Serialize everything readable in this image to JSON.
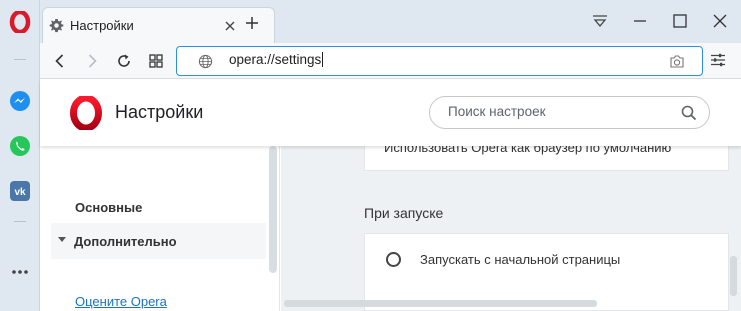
{
  "tab": {
    "title": "Настройки"
  },
  "addressbar": {
    "url": "opera://settings"
  },
  "header": {
    "title": "Настройки",
    "search_placeholder": "Поиск настроек"
  },
  "nav": {
    "basic": "Основные",
    "advanced": "Дополнительно",
    "rate": "Оцените Opera"
  },
  "content": {
    "default_browser": "Использовать Opera как браузер по умолчанию",
    "startup_heading": "При запуске",
    "startup_option": "Запускать с начальной страницы"
  },
  "icons": {
    "opera": "opera-logo-icon",
    "messenger": "messenger-icon",
    "whatsapp": "whatsapp-icon",
    "vk": "vk-icon",
    "more": "more-icon"
  },
  "colors": {
    "opera_red": "#d9192c",
    "accent_blue": "#2d8ee8",
    "link": "#1a73c7"
  }
}
